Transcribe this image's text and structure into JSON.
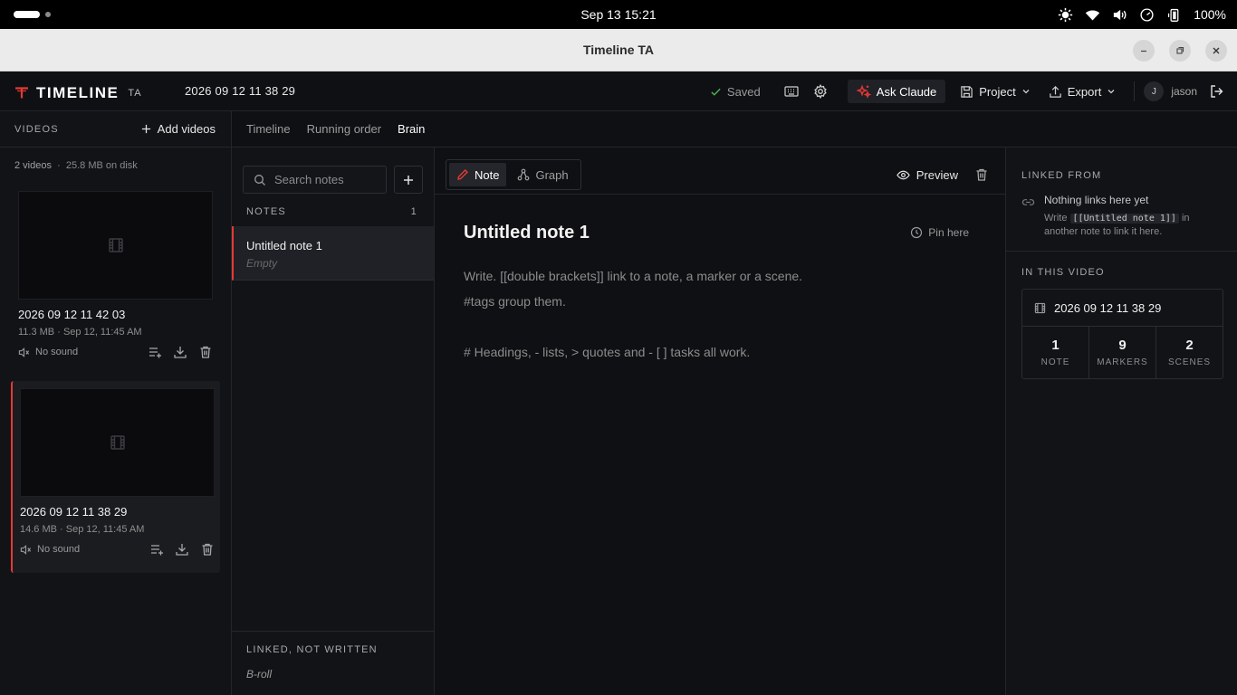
{
  "system": {
    "clock": "Sep 13  15:21",
    "battery": "100%"
  },
  "window": {
    "title": "Timeline TA"
  },
  "header": {
    "logo_text": "TIMELINE",
    "logo_suffix": "TA",
    "project_name": "2026 09 12 11 38 29",
    "saved_label": "Saved",
    "ask_label": "Ask Claude",
    "project_label": "Project",
    "export_label": "Export",
    "user_initial": "J",
    "user_name": "jason",
    "accent": "#e53935"
  },
  "videos": {
    "title": "VIDEOS",
    "add_label": "Add videos",
    "count": "2 videos",
    "disk": "25.8 MB on disk",
    "items": [
      {
        "name": "2026 09 12 11 42 03",
        "size": "11.3 MB",
        "date": "Sep 12, 11:45 AM",
        "sound": "No sound"
      },
      {
        "name": "2026 09 12 11 38 29",
        "size": "14.6 MB",
        "date": "Sep 12, 11:45 AM",
        "sound": "No sound"
      }
    ]
  },
  "tabs": [
    {
      "label": "Timeline"
    },
    {
      "label": "Running order"
    },
    {
      "label": "Brain"
    }
  ],
  "notes": {
    "search_placeholder": "Search notes",
    "header": "NOTES",
    "count": "1",
    "items": [
      {
        "title": "Untitled note 1",
        "subtitle": "Empty"
      }
    ],
    "linked_title": "LINKED, NOT WRITTEN",
    "linked_items": [
      "B-roll"
    ]
  },
  "editor": {
    "modes": [
      {
        "label": "Note"
      },
      {
        "label": "Graph"
      }
    ],
    "preview_label": "Preview",
    "heading": "Untitled note 1",
    "pin_label": "Pin here",
    "placeholder_lines": [
      "Write. [[double brackets]] link to a note, a marker or a scene.",
      "#tags group them.",
      "# Headings, - lists, > quotes and - [ ] tasks all work."
    ]
  },
  "right": {
    "linked_from_title": "LINKED FROM",
    "linked_empty": "Nothing links here yet",
    "linked_hint_pre": "Write",
    "linked_hint_code": "[[Untitled note 1]]",
    "linked_hint_post": "in another note to link it here.",
    "in_video_title": "IN THIS VIDEO",
    "video_name": "2026 09 12 11 38 29",
    "stats": [
      {
        "value": "1",
        "label": "NOTE"
      },
      {
        "value": "9",
        "label": "MARKERS"
      },
      {
        "value": "2",
        "label": "SCENES"
      }
    ]
  }
}
